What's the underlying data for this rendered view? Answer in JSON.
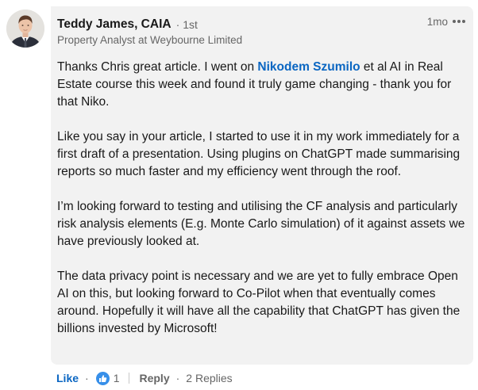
{
  "comment": {
    "author": {
      "name": "Teddy James, CAIA",
      "connection_degree": "1st",
      "headline": "Property Analyst at Weybourne Limited",
      "avatar_icon": "profile-photo"
    },
    "time": "1mo",
    "paragraphs": [
      {
        "before": "Thanks Chris great article. I went on ",
        "mention": "Nikodem Szumilo",
        "after": " et al AI in Real Estate course this week and found it truly game changing - thank you for that Niko."
      },
      "Like you say in your article, I started to use it in my work immediately for a first draft of a presentation. Using plugins on ChatGPT made summarising reports so much faster and my efficiency went through the roof.",
      "I’m looking forward to testing and utilising the CF analysis and particularly risk analysis elements (E.g. Monte Carlo simulation) of it against assets we have previously looked at.",
      "The data privacy point is necessary and we are yet to fully embrace Open AI on this, but looking forward to Co-Pilot when that eventually comes around. Hopefully it will have all the capability that ChatGPT has given the billions invested by Microsoft!"
    ]
  },
  "actions": {
    "like_label": "Like",
    "separator": "·",
    "reaction_icon": "thumbs-up-icon",
    "reaction_count": "1",
    "reply_label": "Reply",
    "replies_label": "2 Replies"
  },
  "colors": {
    "bubble_bg": "#f2f2f2",
    "link_blue": "#0a66c2",
    "reaction_blue": "#378fe9",
    "text": "#191919",
    "muted": "#666666"
  }
}
